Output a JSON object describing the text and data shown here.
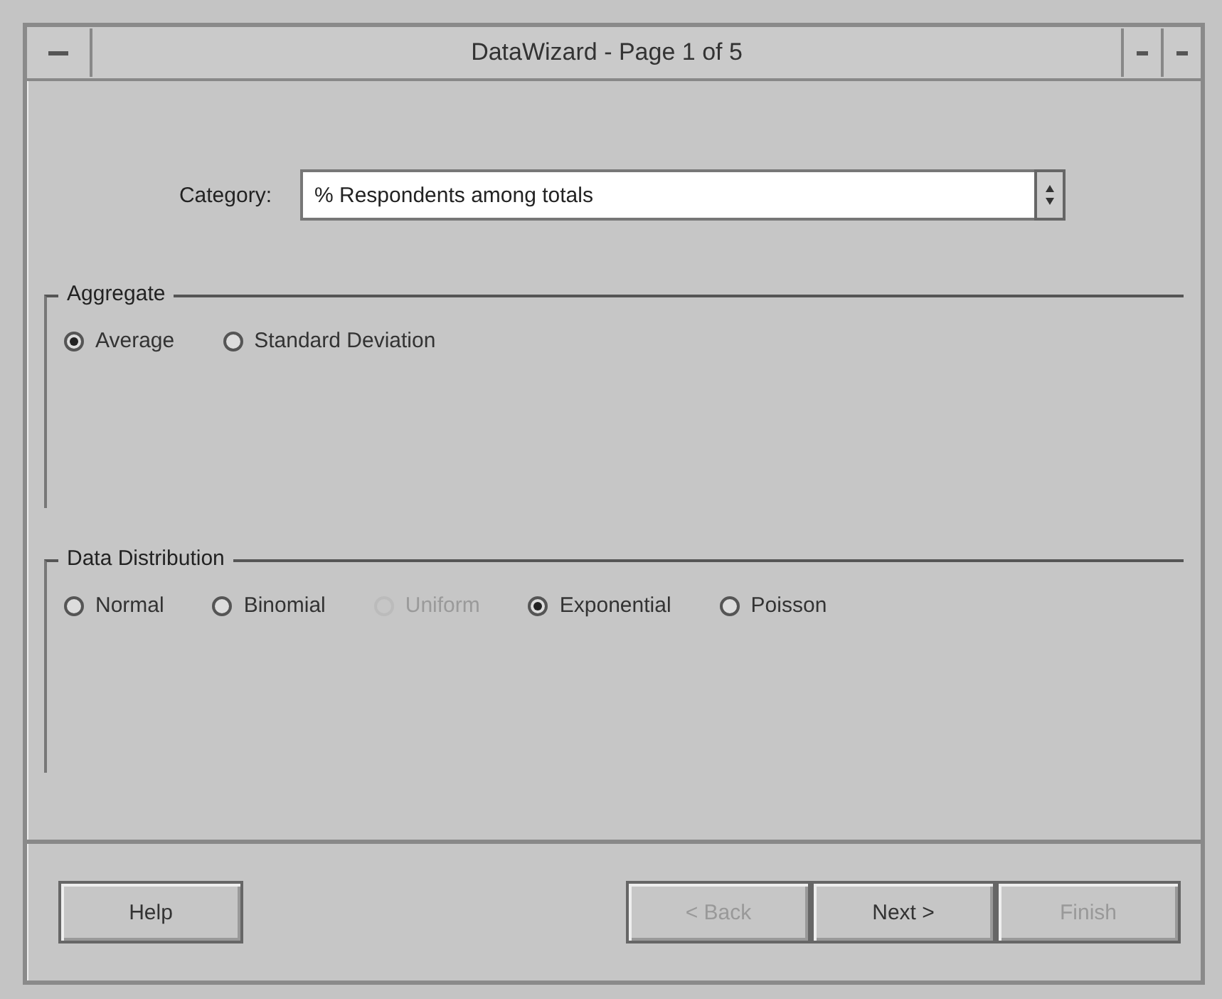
{
  "window": {
    "title": "DataWizard - Page 1 of 5"
  },
  "category": {
    "label": "Category:",
    "value": "% Respondents among totals"
  },
  "groups": [
    {
      "title": "Aggregate",
      "options": [
        {
          "label": "Average",
          "selected": true,
          "disabled": false
        },
        {
          "label": "Standard Deviation",
          "selected": false,
          "disabled": false
        }
      ]
    },
    {
      "title": "Data Distribution",
      "options": [
        {
          "label": "Normal",
          "selected": false,
          "disabled": false
        },
        {
          "label": "Binomial",
          "selected": false,
          "disabled": false
        },
        {
          "label": "Uniform",
          "selected": false,
          "disabled": true
        },
        {
          "label": "Exponential",
          "selected": true,
          "disabled": false
        },
        {
          "label": "Poisson",
          "selected": false,
          "disabled": false
        }
      ]
    }
  ],
  "buttons": [
    {
      "label": "Help",
      "disabled": false
    },
    {
      "label": "< Back",
      "disabled": true
    },
    {
      "label": "Next >",
      "disabled": false
    },
    {
      "label": "Finish",
      "disabled": true
    }
  ]
}
